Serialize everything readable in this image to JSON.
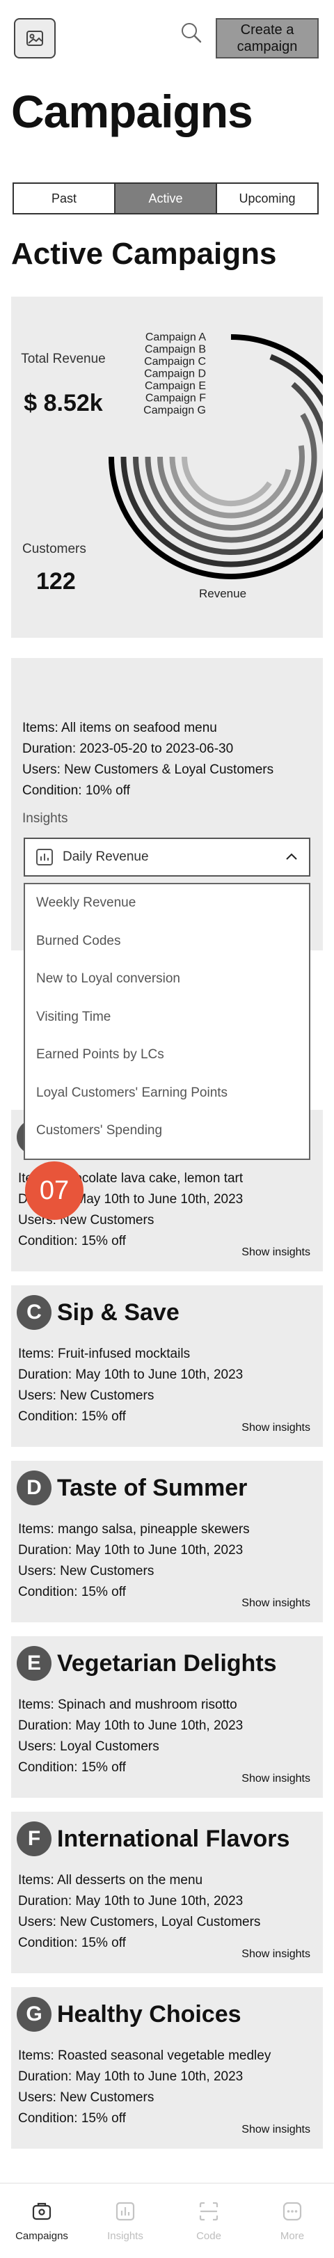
{
  "header": {
    "logo_icon": "image-icon",
    "search_icon": "search-icon",
    "create_button": "Create a campaign",
    "title": "Campaigns"
  },
  "tabs": [
    {
      "label": "Past",
      "active": false
    },
    {
      "label": "Active",
      "active": true
    },
    {
      "label": "Upcoming",
      "active": false
    }
  ],
  "section_title": "Active Campaigns",
  "summary": {
    "total_revenue_label": "Total Revenue",
    "total_revenue_value": "$ 8.52k",
    "customers_label": "Customers",
    "customers_value": "122"
  },
  "chart_data": {
    "type": "radial-bar",
    "xlabel": "Revenue",
    "categories": [
      "Campaign A",
      "Campaign B",
      "Campaign C",
      "Campaign D",
      "Campaign E",
      "Campaign F",
      "Campaign G"
    ],
    "values": [
      100,
      92,
      85,
      78,
      70,
      62,
      54
    ],
    "colors": [
      "#000000",
      "#2e2e2e",
      "#4a4a4a",
      "#666666",
      "#808080",
      "#999999",
      "#b3b3b3"
    ]
  },
  "expanded_card": {
    "items": "Items: All items on seafood menu",
    "duration": "Duration: 2023-05-20 to 2023-06-30",
    "users": "Users: New Customers & Loyal Customers",
    "condition": "Condition: 10% off",
    "insights_label": "Insights",
    "selected_insight": "Daily Revenue",
    "dropdown_options": [
      "Weekly Revenue",
      "Burned Codes",
      "New to Loyal conversion",
      "Visiting Time",
      "Earned Points by LCs",
      "Loyal Customers' Earning Points",
      "Customers' Spending"
    ]
  },
  "step_marker": "07",
  "campaigns": [
    {
      "badge": "B",
      "name": "",
      "items": "Items: Chocolate lava cake, lemon tart",
      "duration": "Duration: May 10th to June 10th, 2023",
      "users": "Users: New Customers",
      "condition": "Condition: 15% off",
      "link": "Show insights"
    },
    {
      "badge": "C",
      "name": "Sip & Save",
      "items": "Items: Fruit-infused mocktails",
      "duration": "Duration: May 10th to June 10th, 2023",
      "users": "Users: New Customers",
      "condition": "Condition: 15% off",
      "link": "Show insights"
    },
    {
      "badge": "D",
      "name": "Taste of Summer",
      "items": "Items: mango salsa, pineapple skewers",
      "duration": "Duration: May 10th to June 10th, 2023",
      "users": "Users: New Customers",
      "condition": "Condition: 15% off",
      "link": "Show insights"
    },
    {
      "badge": "E",
      "name": "Vegetarian Delights",
      "items": "Items: Spinach and mushroom risotto",
      "duration": "Duration: May 10th to June 10th, 2023",
      "users": "Users: Loyal Customers",
      "condition": "Condition: 15% off",
      "link": "Show insights"
    },
    {
      "badge": "F",
      "name": "International Flavors",
      "items": "Items: All desserts on the menu",
      "duration": "Duration: May 10th to June 10th, 2023",
      "users": "Users: New Customers, Loyal Customers",
      "condition": "Condition: 15% off",
      "link": "Show insights"
    },
    {
      "badge": "G",
      "name": "Healthy Choices",
      "items": "Items: Roasted seasonal vegetable medley",
      "duration": "Duration: May 10th to June 10th, 2023",
      "users": "Users: New Customers",
      "condition": "Condition: 15% off",
      "link": "Show insights"
    }
  ],
  "bottom_nav": [
    {
      "label": "Campaigns",
      "icon": "campaign-icon",
      "active": true
    },
    {
      "label": "Insights",
      "icon": "insights-icon",
      "active": false
    },
    {
      "label": "Code",
      "icon": "code-scan-icon",
      "active": false
    },
    {
      "label": "More",
      "icon": "more-icon",
      "active": false
    }
  ]
}
